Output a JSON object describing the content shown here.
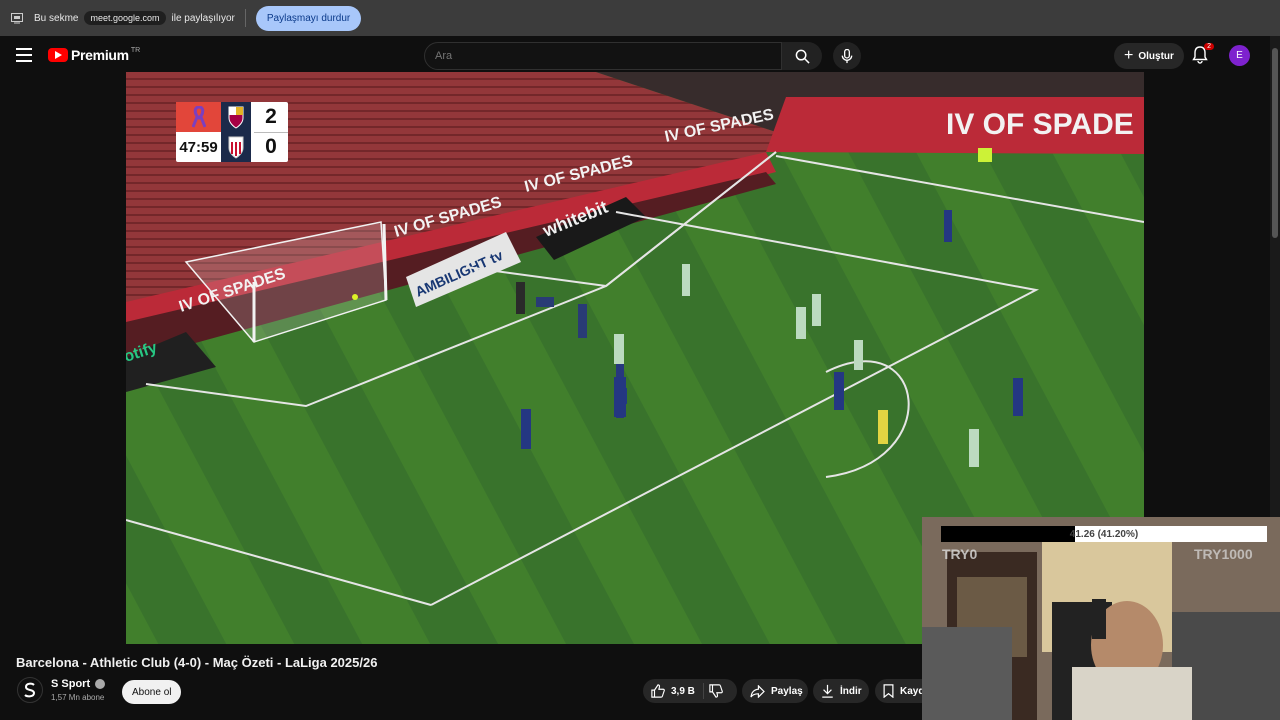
{
  "share_bar": {
    "prefix": "Bu sekme",
    "domain": "meet.google.com",
    "suffix": "ile paylaşılıyor",
    "stop_label": "Paylaşmayı durdur"
  },
  "header": {
    "logo_text": "Premium",
    "logo_region": "TR",
    "search_placeholder": "Ara",
    "create_label": "Oluştur",
    "notification_count": "2",
    "avatar_letter": "E"
  },
  "scorebug": {
    "time": "47:59",
    "home_score": "2",
    "away_score": "0"
  },
  "video": {
    "title": "Barcelona - Athletic Club (4-0) - Maç Özeti - LaLiga 2025/26",
    "channel_name": "S Sport",
    "subscribers": "1,57 Mn abone",
    "subscribe_label": "Abone ol",
    "like_count": "3,9 B",
    "share_label": "Paylaş",
    "download_label": "İndir",
    "save_label": "Kayd"
  },
  "webcam_overlay": {
    "progress_text": "41.26 (41.20%)",
    "progress_fraction": 0.412,
    "left_text": "TRY0",
    "right_text": "TRY1000"
  }
}
